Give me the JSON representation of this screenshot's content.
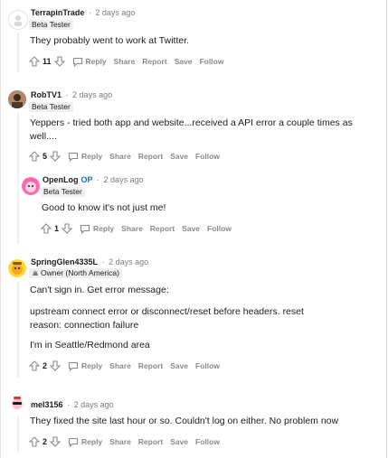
{
  "comments": [
    {
      "author": "TerrapinTrade",
      "time": "2 days ago",
      "flair": "Beta Tester",
      "text": "They probably went to work at Twitter.",
      "votes": "11"
    },
    {
      "author": "RobTV1",
      "time": "2 days ago",
      "flair": "Beta Tester",
      "text": "Yeppers - tried both app and website...received a API error a couple times as well....",
      "votes": "5"
    },
    {
      "author": "OpenLog",
      "op_label": "OP",
      "time": "2 days ago",
      "flair": "Beta Tester",
      "text": "Good to know it's not just me!",
      "votes": "1"
    },
    {
      "author": "SpringGlen4335L",
      "time": "2 days ago",
      "flair": "Owner (North America)",
      "text1": "Can't sign in. Get error message:",
      "text2": "upstream connect error or disconnect/reset before headers. reset reason: connection failure",
      "text3": "I'm in Seattle/Redmond area",
      "votes": "2"
    },
    {
      "author": "mel3156",
      "time": "2 days ago",
      "text": "They fixed the site last hour or so. Couldn't log on either. No problem now",
      "votes": "2"
    }
  ],
  "actions": {
    "reply": "Reply",
    "share": "Share",
    "report": "Report",
    "save": "Save",
    "follow": "Follow"
  },
  "separator": "·"
}
